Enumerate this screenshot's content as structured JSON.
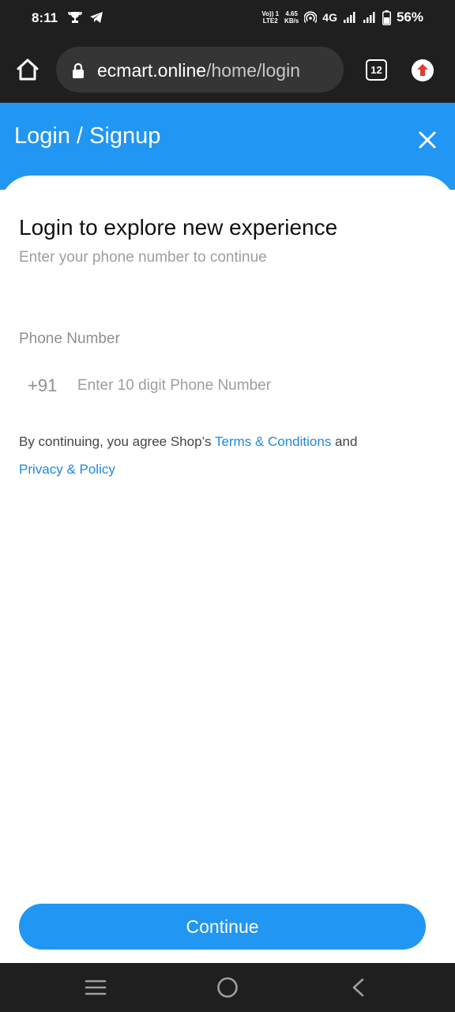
{
  "status_bar": {
    "time": "8:11",
    "volte_top": "Vo)) 1",
    "volte_bottom": "LTE2",
    "speed_top": "4.65",
    "speed_bottom": "KB/s",
    "network": "4G",
    "battery": "56%"
  },
  "browser": {
    "url_domain": "ecmart.online",
    "url_path": "/home/login",
    "tab_count": "12"
  },
  "header": {
    "title": "Login / Signup"
  },
  "login": {
    "heading": "Login to explore new experience",
    "subheading": "Enter your phone number to continue",
    "phone_label": "Phone Number",
    "country_code": "+91",
    "phone_placeholder": "Enter 10 digit Phone Number",
    "phone_value": "",
    "terms_prefix": "By continuing, you agree Shop’s ",
    "terms_link": "Terms & Conditions",
    "terms_and": " and",
    "privacy_link": "Privacy & Policy"
  },
  "actions": {
    "continue_label": "Continue"
  },
  "colors": {
    "primary": "#2196f3",
    "link": "#1e88e5",
    "system_bar": "#1f1f1f"
  },
  "icons": [
    "trophy-icon",
    "telegram-icon",
    "hotspot-icon",
    "signal-icon",
    "battery-icon",
    "home-icon",
    "lock-icon",
    "tabs-icon",
    "update-icon",
    "close-icon",
    "menu-icon",
    "circle-home-icon",
    "back-icon"
  ]
}
